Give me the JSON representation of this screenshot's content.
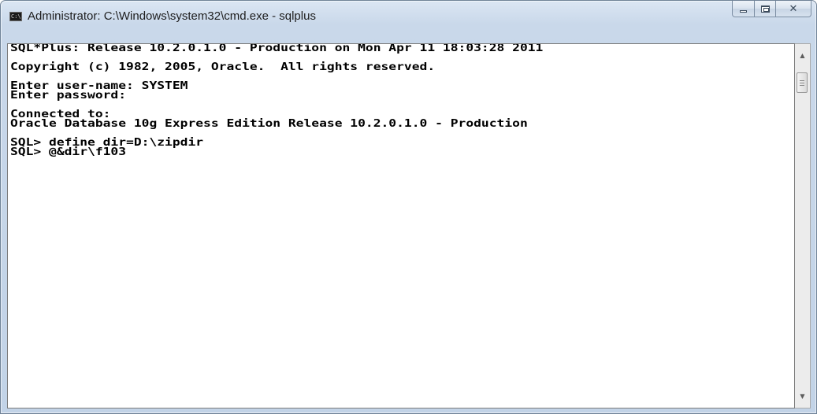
{
  "window": {
    "title": "Administrator: C:\\Windows\\system32\\cmd.exe - sqlplus",
    "app_icon_text": "C:\\"
  },
  "caption_buttons": {
    "close_glyph": "✕"
  },
  "console": {
    "lines": [
      "SQL*Plus: Release 10.2.0.1.0 - Production on Mon Apr 11 18:03:28 2011",
      "",
      "Copyright (c) 1982, 2005, Oracle.  All rights reserved.",
      "",
      "Enter user-name: SYSTEM",
      "Enter password:",
      "",
      "Connected to:",
      "Oracle Database 10g Express Edition Release 10.2.0.1.0 - Production",
      "",
      "SQL> define dir=D:\\zipdir",
      "SQL> @&dir\\f103"
    ]
  },
  "scrollbar": {
    "up_arrow": "▲",
    "down_arrow": "▼"
  }
}
